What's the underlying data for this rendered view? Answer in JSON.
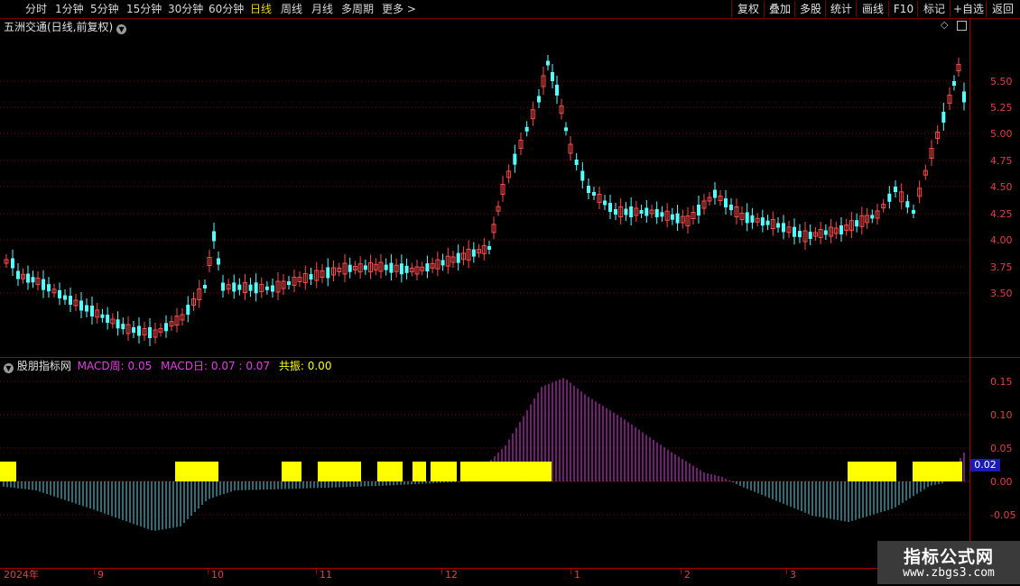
{
  "colors": {
    "up": "#ff4a4a",
    "down": "#54ffff",
    "macd_pos": "#e040e0",
    "macd_neg": "#56d8e8",
    "resonance": "#ffff00",
    "grid": "#8a0000",
    "axis": "#e04040"
  },
  "toolbar": {
    "periods": [
      "分时",
      "1分钟",
      "5分钟",
      "15分钟",
      "30分钟",
      "60分钟",
      "日线",
      "周线",
      "月线",
      "多周期",
      "更多"
    ],
    "active_period": "日线",
    "right_buttons": [
      "复权",
      "叠加",
      "多股",
      "统计",
      "画线",
      "F10",
      "标记",
      "+自选",
      "返回"
    ]
  },
  "main_panel": {
    "title": "五洲交通(日线,前复权)",
    "price_ticks": [
      "5.50",
      "5.25",
      "5.00",
      "4.75",
      "4.50",
      "4.25",
      "4.00",
      "3.75",
      "3.50"
    ]
  },
  "indicator": {
    "name": "股朋指标网",
    "macd_week_label": "MACD周:",
    "macd_week_value": "0.05",
    "macd_day_label": "MACD日:",
    "macd_day_value": "0.07",
    "macd_day_value2": "0.07",
    "resonance_label": "共振:",
    "resonance_value": "0.00",
    "ticks": [
      "0.15",
      "0.10",
      "0.05",
      "0.00",
      "-0.05"
    ],
    "current_value": "0.02"
  },
  "date_axis": {
    "labels": [
      "2024年",
      "9",
      "10",
      "11",
      "12",
      "1",
      "2",
      "3"
    ]
  },
  "watermark": {
    "title": "指标公式网",
    "url": "www.zbgs3.com"
  }
}
